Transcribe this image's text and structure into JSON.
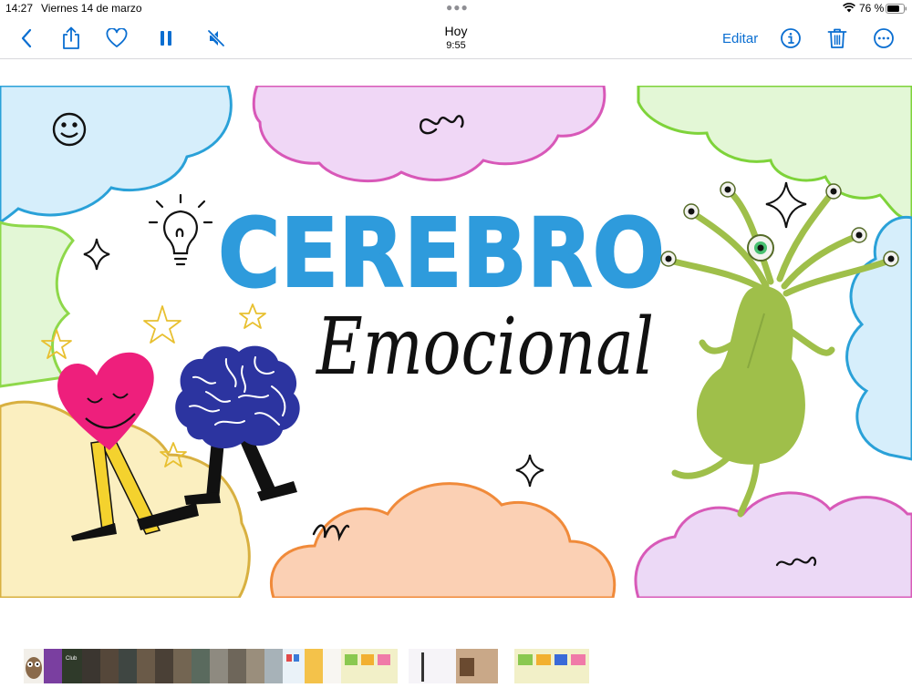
{
  "status_bar": {
    "time": "14:27",
    "date": "Viernes 14 de marzo",
    "battery_percent_label": "76 %",
    "battery_level": 0.76
  },
  "toolbar": {
    "title": "Hoy",
    "subtitle": "9:55",
    "edit_label": "Editar",
    "accent": "#0a6ed1",
    "icons": [
      "back-chevron-icon",
      "share-icon",
      "heart-icon",
      "pause-icon",
      "mute-icon",
      "info-icon",
      "trash-icon",
      "more-icon"
    ]
  },
  "photo": {
    "headline": "CEREBRO",
    "subheadline": "Emocional",
    "colors": {
      "headline": "#2e9bdc",
      "blue_cloud": "#d6eefb",
      "pink_cloud": "#f0d7f6",
      "green_cloud": "#e3f7d6",
      "yellow_cloud": "#fbefc0",
      "peach_cloud": "#fbd0b4",
      "lilac_cloud": "#ecd9f6",
      "heart": "#ee1f7c",
      "brain": "#2c34a0",
      "creature": "#9fbf4a"
    }
  },
  "filmstrip": {
    "thumb_captions": [
      "Club"
    ]
  }
}
